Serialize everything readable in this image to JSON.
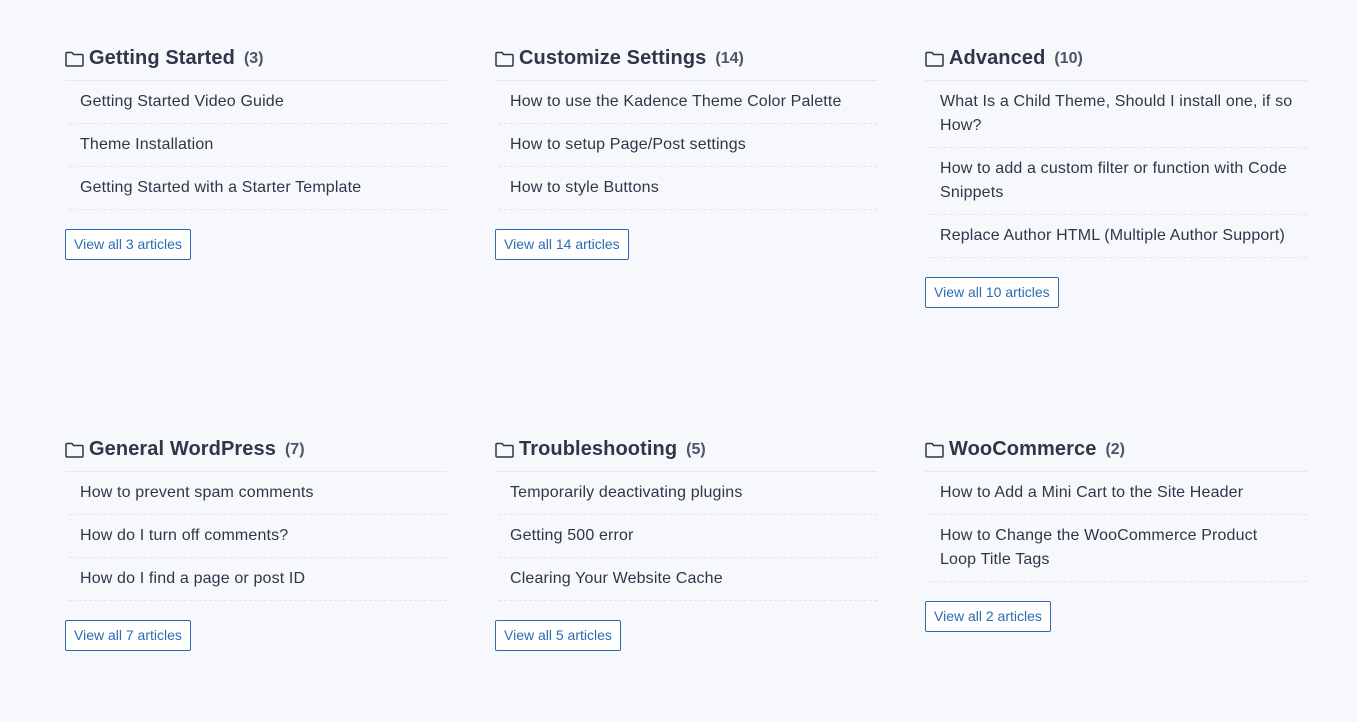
{
  "categories": [
    {
      "title": "Getting Started",
      "count": "(3)",
      "articles": [
        "Getting Started Video Guide",
        "Theme Installation",
        "Getting Started with a Starter Template"
      ],
      "view_all": "View all 3 articles"
    },
    {
      "title": "Customize Settings",
      "count": "(14)",
      "articles": [
        "How to use the Kadence Theme Color Palette",
        "How to setup Page/Post settings",
        "How to style Buttons"
      ],
      "view_all": "View all 14 articles"
    },
    {
      "title": "Advanced",
      "count": "(10)",
      "articles": [
        "What Is a Child Theme, Should I install one, if so How?",
        "How to add a custom filter or function with Code Snippets",
        "Replace Author HTML (Multiple Author Support)"
      ],
      "view_all": "View all 10 articles"
    },
    {
      "title": "General WordPress",
      "count": "(7)",
      "articles": [
        "How to prevent spam comments",
        "How do I turn off comments?",
        "How do I find a page or post ID"
      ],
      "view_all": "View all 7 articles"
    },
    {
      "title": "Troubleshooting",
      "count": "(5)",
      "articles": [
        "Temporarily deactivating plugins",
        "Getting 500 error",
        "Clearing Your Website Cache"
      ],
      "view_all": "View all 5 articles"
    },
    {
      "title": "WooCommerce",
      "count": "(2)",
      "articles": [
        "How to Add a Mini Cart to the Site Header",
        "How to Change the WooCommerce Product Loop Title Tags"
      ],
      "view_all": "View all 2 articles"
    }
  ],
  "icons": {
    "category": "folder-icon"
  },
  "colors": {
    "accent": "#2b6cb0",
    "background": "#f7f8fc",
    "text": "#2d3748"
  }
}
